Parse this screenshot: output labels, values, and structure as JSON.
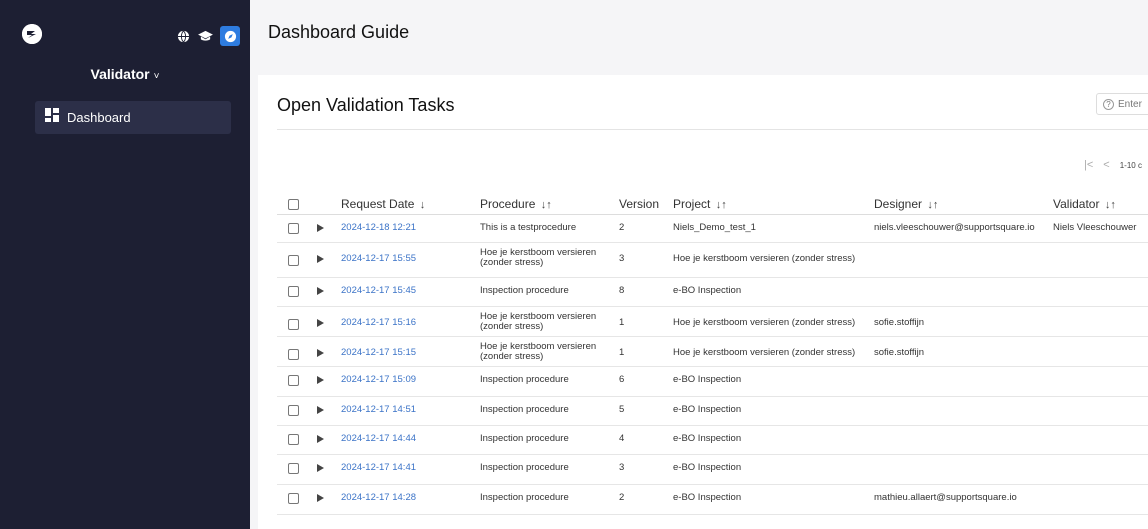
{
  "sidebar": {
    "role": "Validator",
    "role_chevron": "˅",
    "icons": [
      "globe-icon",
      "graduation-cap-icon",
      "compass-icon"
    ],
    "nav": [
      {
        "label": "Dashboard",
        "icon": "dashboard-icon"
      }
    ]
  },
  "header": {
    "title": "Dashboard Guide"
  },
  "card": {
    "title": "Open Validation Tasks",
    "enter_label": "Enter",
    "pager_first": "|<",
    "pager_prev": "<",
    "pager_range": "1-10 c"
  },
  "table": {
    "headers": {
      "request_date": "Request Date",
      "request_date_sort": "↓",
      "procedure": "Procedure",
      "version": "Version",
      "project": "Project",
      "designer": "Designer",
      "validator": "Validator",
      "sort_icon": "↓↑"
    },
    "rows": [
      {
        "date": "2024-12-18 12:21",
        "procedure": "This is a testprocedure",
        "version": "2",
        "project": "Niels_Demo_test_1",
        "designer": "niels.vleeschouwer@supportsquare.io",
        "validator": "Niels Vleeschouwer"
      },
      {
        "date": "2024-12-17 15:55",
        "procedure": "Hoe je kerstboom versieren (zonder stress)",
        "version": "3",
        "project": "Hoe je kerstboom versieren (zonder stress)",
        "designer": "",
        "validator": ""
      },
      {
        "date": "2024-12-17 15:45",
        "procedure": "Inspection procedure",
        "version": "8",
        "project": "e-BO Inspection",
        "designer": "",
        "validator": ""
      },
      {
        "date": "2024-12-17 15:16",
        "procedure": "Hoe je kerstboom versieren (zonder stress)",
        "version": "1",
        "project": "Hoe je kerstboom versieren (zonder stress)",
        "designer": "sofie.stoffijn",
        "validator": ""
      },
      {
        "date": "2024-12-17 15:15",
        "procedure": "Hoe je kerstboom versieren (zonder stress)",
        "version": "1",
        "project": "Hoe je kerstboom versieren (zonder stress)",
        "designer": "sofie.stoffijn",
        "validator": ""
      },
      {
        "date": "2024-12-17 15:09",
        "procedure": "Inspection procedure",
        "version": "6",
        "project": "e-BO Inspection",
        "designer": "",
        "validator": ""
      },
      {
        "date": "2024-12-17 14:51",
        "procedure": "Inspection procedure",
        "version": "5",
        "project": "e-BO Inspection",
        "designer": "",
        "validator": ""
      },
      {
        "date": "2024-12-17 14:44",
        "procedure": "Inspection procedure",
        "version": "4",
        "project": "e-BO Inspection",
        "designer": "",
        "validator": ""
      },
      {
        "date": "2024-12-17 14:41",
        "procedure": "Inspection procedure",
        "version": "3",
        "project": "e-BO Inspection",
        "designer": "",
        "validator": ""
      },
      {
        "date": "2024-12-17 14:28",
        "procedure": "Inspection procedure",
        "version": "2",
        "project": "e-BO Inspection",
        "designer": "mathieu.allaert@supportsquare.io",
        "validator": ""
      }
    ]
  },
  "colors": {
    "sidebar": "#1d1f33",
    "accent": "#2e7ce0",
    "link": "#3b73c7"
  }
}
